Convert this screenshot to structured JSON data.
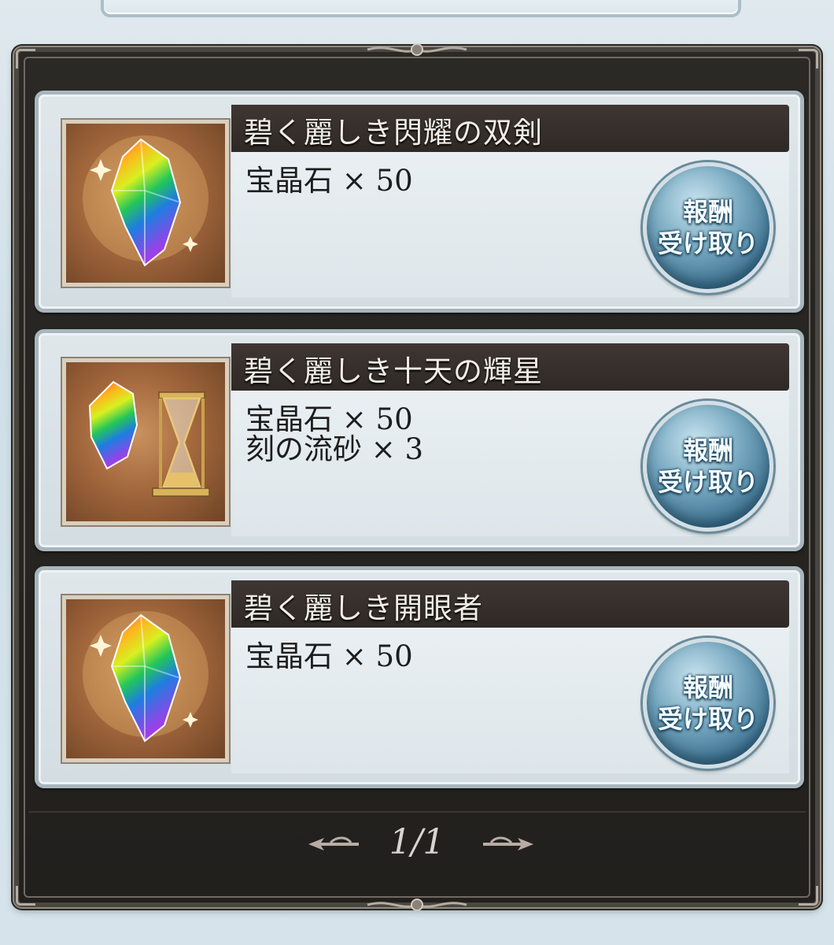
{
  "rewards": [
    {
      "title": "碧く麗しき閃耀の双剣",
      "items": [
        "宝晶石 × 50"
      ],
      "claim_label_top": "報酬",
      "claim_label_bottom": "受け取り",
      "icon": "rainbow-crystal-icon"
    },
    {
      "title": "碧く麗しき十天の輝星",
      "items": [
        "宝晶石 × 50",
        "刻の流砂 × 3"
      ],
      "claim_label_top": "報酬",
      "claim_label_bottom": "受け取り",
      "icon": "crystal-and-hourglass-icon"
    },
    {
      "title": "碧く麗しき開眼者",
      "items": [
        "宝晶石 × 50"
      ],
      "claim_label_top": "報酬",
      "claim_label_bottom": "受け取り",
      "icon": "rainbow-crystal-icon"
    }
  ],
  "pagination": {
    "text": "1/1",
    "prev_icon": "arrow-left-icon",
    "next_icon": "arrow-right-icon"
  },
  "colors": {
    "panel_bg": "#22201d",
    "title_bar": "#2f2925",
    "card_bg": "#dde6ea",
    "button_blue": "#3f7391"
  }
}
